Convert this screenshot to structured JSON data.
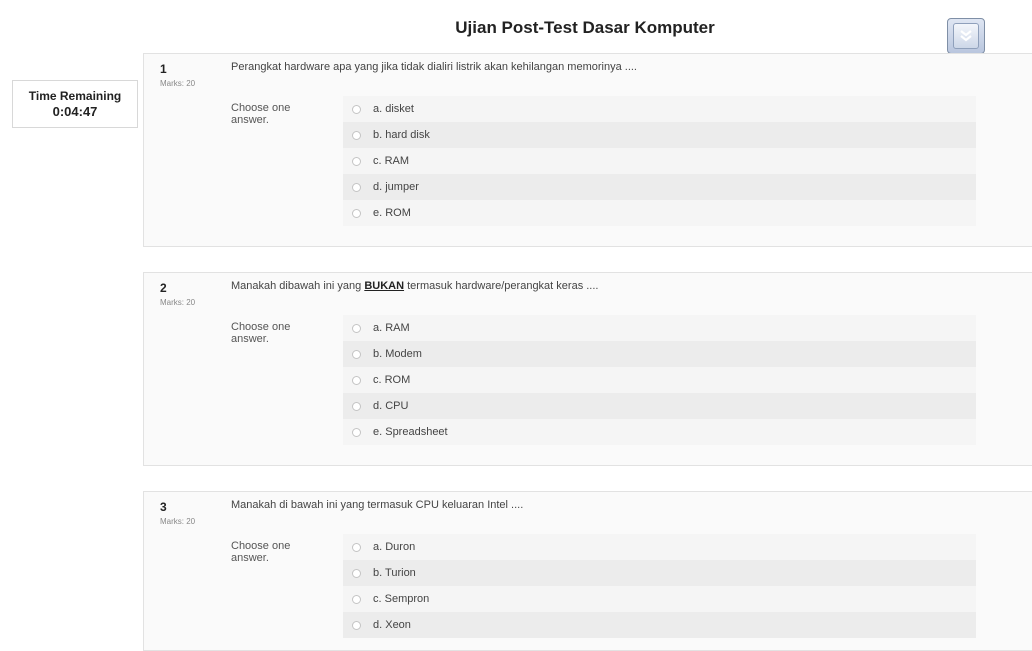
{
  "page": {
    "title": "Ujian Post-Test Dasar Komputer"
  },
  "timer": {
    "label": "Time Remaining",
    "value": "0:04:47"
  },
  "icons": {
    "scroll_button": "double-chevron-down-icon"
  },
  "questions": [
    {
      "number": "1",
      "marks": "Marks: 20",
      "text_before": "Perangkat hardware apa yang jika tidak dialiri listrik akan kehilangan memorinya ....",
      "text_emph": "",
      "text_after": "",
      "choose_label": "Choose one answer.",
      "options": [
        "a. disket",
        "b. hard disk",
        "c. RAM",
        "d. jumper",
        "e. ROM"
      ]
    },
    {
      "number": "2",
      "marks": "Marks: 20",
      "text_before": "Manakah dibawah ini yang ",
      "text_emph": "BUKAN",
      "text_after": " termasuk hardware/perangkat keras ....",
      "choose_label": "Choose one answer.",
      "options": [
        "a. RAM",
        "b. Modem",
        "c. ROM",
        "d. CPU",
        "e. Spreadsheet"
      ]
    },
    {
      "number": "3",
      "marks": "Marks: 20",
      "text_before": "Manakah di bawah ini yang termasuk CPU keluaran Intel ....",
      "text_emph": "",
      "text_after": "",
      "choose_label": "Choose one answer.",
      "options": [
        "a. Duron",
        "b. Turion",
        "c. Sempron",
        "d. Xeon"
      ]
    }
  ]
}
